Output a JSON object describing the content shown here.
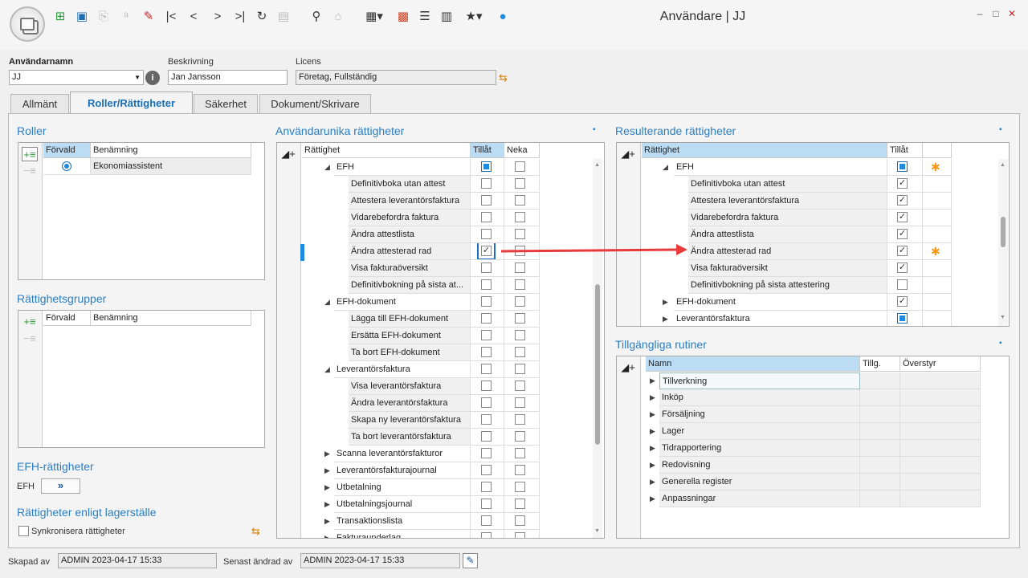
{
  "window": {
    "title": "Användare | JJ"
  },
  "header": {
    "username_label": "Användarnamn",
    "username_value": "JJ",
    "desc_label": "Beskrivning",
    "desc_value": "Jan Jansson",
    "license_label": "Licens",
    "license_value": "Företag, Fullständig"
  },
  "tabs": [
    "Allmänt",
    "Roller/Rättigheter",
    "Säkerhet",
    "Dokument/Skrivare"
  ],
  "roles": {
    "title": "Roller",
    "col_default": "Förvald",
    "col_name": "Benämning",
    "rows": [
      {
        "name": "Ekonomiassistent"
      }
    ]
  },
  "groups": {
    "title": "Rättighetsgrupper",
    "col_default": "Förvald",
    "col_name": "Benämning"
  },
  "efh": {
    "title": "EFH-rättigheter",
    "label": "EFH"
  },
  "warehouse": {
    "title": "Rättigheter enligt lagerställe",
    "sync_label": "Synkronisera rättigheter"
  },
  "user_rights": {
    "title": "Användarunika rättigheter",
    "col_right": "Rättighet",
    "col_allow": "Tillåt",
    "col_deny": "Neka",
    "rows": [
      {
        "label": "EFH",
        "level": 0,
        "exp": "open",
        "allow": "partial",
        "deny": false
      },
      {
        "label": "Definitivboka utan attest",
        "level": 1,
        "allow": false,
        "deny": false
      },
      {
        "label": "Attestera leverantörsfaktura",
        "level": 1,
        "allow": false,
        "deny": false
      },
      {
        "label": "Vidarebefordra faktura",
        "level": 1,
        "allow": false,
        "deny": false
      },
      {
        "label": "Ändra attestlista",
        "level": 1,
        "allow": false,
        "deny": false
      },
      {
        "label": "Ändra attesterad rad",
        "level": 1,
        "allow": true,
        "deny": false,
        "focus": true
      },
      {
        "label": "Visa fakturaöversikt",
        "level": 1,
        "allow": false,
        "deny": false
      },
      {
        "label": "Definitivbokning på sista at...",
        "level": 1,
        "allow": false,
        "deny": false
      },
      {
        "label": "EFH-dokument",
        "level": 0,
        "exp": "open",
        "allow": false,
        "deny": false
      },
      {
        "label": "Lägga till EFH-dokument",
        "level": 1,
        "allow": false,
        "deny": false
      },
      {
        "label": "Ersätta EFH-dokument",
        "level": 1,
        "allow": false,
        "deny": false
      },
      {
        "label": "Ta bort EFH-dokument",
        "level": 1,
        "allow": false,
        "deny": false
      },
      {
        "label": "Leverantörsfaktura",
        "level": 0,
        "exp": "open",
        "allow": false,
        "deny": false
      },
      {
        "label": "Visa leverantörsfaktura",
        "level": 1,
        "allow": false,
        "deny": false
      },
      {
        "label": "Ändra leverantörsfaktura",
        "level": 1,
        "allow": false,
        "deny": false
      },
      {
        "label": "Skapa ny leverantörsfaktura",
        "level": 1,
        "allow": false,
        "deny": false
      },
      {
        "label": "Ta bort leverantörsfaktura",
        "level": 1,
        "allow": false,
        "deny": false
      },
      {
        "label": "Scanna leverantörsfakturor",
        "level": 0,
        "exp": "closed",
        "allow": false,
        "deny": false
      },
      {
        "label": "Leverantörsfakturajournal",
        "level": 0,
        "exp": "closed",
        "allow": false,
        "deny": false
      },
      {
        "label": "Utbetalning",
        "level": 0,
        "exp": "closed",
        "allow": false,
        "deny": false
      },
      {
        "label": "Utbetalningsjournal",
        "level": 0,
        "exp": "closed",
        "allow": false,
        "deny": false
      },
      {
        "label": "Transaktionslista",
        "level": 0,
        "exp": "closed",
        "allow": false,
        "deny": false
      },
      {
        "label": "Fakturaunderlag",
        "level": 0,
        "exp": "closed",
        "allow": false,
        "deny": false
      }
    ]
  },
  "result_rights": {
    "title": "Resulterande rättigheter",
    "col_right": "Rättighet",
    "col_allow": "Tillåt",
    "rows": [
      {
        "label": "EFH",
        "level": 0,
        "exp": "open",
        "allow": "partial",
        "star": true
      },
      {
        "label": "Definitivboka utan attest",
        "level": 1,
        "allow": true
      },
      {
        "label": "Attestera leverantörsfaktura",
        "level": 1,
        "allow": true
      },
      {
        "label": "Vidarebefordra faktura",
        "level": 1,
        "allow": true
      },
      {
        "label": "Ändra attestlista",
        "level": 1,
        "allow": true
      },
      {
        "label": "Ändra attesterad rad",
        "level": 1,
        "allow": true,
        "star": true
      },
      {
        "label": "Visa fakturaöversikt",
        "level": 1,
        "allow": true
      },
      {
        "label": "Definitivbokning på sista attestering",
        "level": 1,
        "allow": false
      },
      {
        "label": "EFH-dokument",
        "level": 0,
        "exp": "closed",
        "allow": true
      },
      {
        "label": "Leverantörsfaktura",
        "level": 0,
        "exp": "closed",
        "allow": "partial"
      }
    ]
  },
  "routines": {
    "title": "Tillgängliga rutiner",
    "col_name": "Namn",
    "col_avail": "Tillg.",
    "col_override": "Överstyr",
    "rows": [
      "Tillverkning",
      "Inköp",
      "Försäljning",
      "Lager",
      "Tidrapportering",
      "Redovisning",
      "Generella register",
      "Anpassningar"
    ]
  },
  "footer": {
    "created_label": "Skapad av",
    "created_value": "ADMIN 2023-04-17 15:33",
    "changed_label": "Senast ändrad av",
    "changed_value": "ADMIN 2023-04-17 15:33"
  },
  "colors": {
    "accent": "#2a7ec4",
    "annotation_arrow": "#e8393b",
    "star": "#f39a1b"
  }
}
